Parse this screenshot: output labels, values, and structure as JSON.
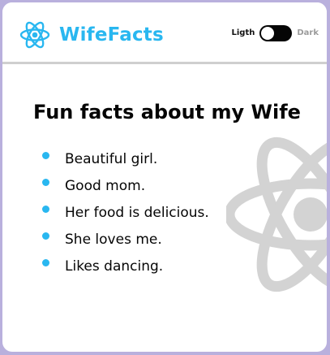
{
  "colors": {
    "accent": "#29b7f0",
    "page_background": "#b9b0dd",
    "card_background": "#ffffff",
    "divider": "#cfcfcf",
    "text": "#050505",
    "background_logo": "#d3d3d3",
    "toggle_track": "#050505",
    "toggle_knob": "#ffffff",
    "dark_label": "#9b9b9b"
  },
  "header": {
    "brand_name": "WifeFacts",
    "brand_icon": "react-atom-icon"
  },
  "theme_toggle": {
    "light_label": "Ligth",
    "dark_label": "Dark",
    "selected_mode": "Ligth"
  },
  "main": {
    "title": "Fun facts about my Wife",
    "facts": [
      "Beautiful girl.",
      "Good mom.",
      "Her food is delicious.",
      "She loves me.",
      "Likes dancing."
    ],
    "background_icon": "react-atom-icon"
  }
}
